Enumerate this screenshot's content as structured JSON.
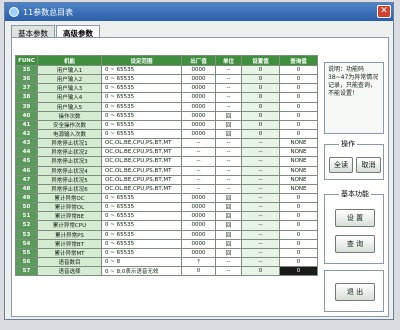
{
  "window": {
    "title": "11参数总目表"
  },
  "tabs": [
    {
      "label": "基本参数"
    },
    {
      "label": "高级参数"
    }
  ],
  "table": {
    "headers": [
      "FUNC",
      "机能",
      "设定范围",
      "出厂值",
      "单位",
      "设置值",
      "查询值"
    ],
    "rows": [
      [
        "35",
        "用户输入1",
        "0 ~ 65535",
        "0000",
        "--",
        "0",
        "0"
      ],
      [
        "36",
        "用户输入2",
        "0 ~ 65535",
        "0000",
        "--",
        "0",
        "0"
      ],
      [
        "37",
        "用户输入3",
        "0 ~ 65535",
        "0000",
        "--",
        "0",
        "0"
      ],
      [
        "38",
        "用户输入4",
        "0 ~ 65535",
        "0000",
        "--",
        "0",
        "0"
      ],
      [
        "39",
        "用户输入5",
        "0 ~ 65535",
        "0000",
        "--",
        "0",
        "0"
      ],
      [
        "40",
        "操作次数",
        "0 ~ 65535",
        "0000",
        "回",
        "0",
        "0"
      ],
      [
        "41",
        "安全操作次数",
        "0 ~ 65535",
        "0000",
        "回",
        "0",
        "0"
      ],
      [
        "42",
        "电源输入次数",
        "0 ~ 65535",
        "0000",
        "回",
        "0",
        "0"
      ],
      [
        "43",
        "异常停止状况1",
        "OC,OL,BE,CPU,PS,BT,MT",
        "--",
        "--",
        "--",
        "NONE"
      ],
      [
        "44",
        "异常停止状况2",
        "OC,OL,BE,CPU,PS,BT,MT",
        "--",
        "--",
        "--",
        "NONE"
      ],
      [
        "45",
        "异常停止状况3",
        "OC,OL,BE,CPU,PS,BT,MT",
        "--",
        "--",
        "--",
        "NONE"
      ],
      [
        "46",
        "异常停止状况4",
        "OC,OL,BE,CPU,PS,BT,MT",
        "--",
        "--",
        "--",
        "NONE"
      ],
      [
        "47",
        "异常停止状况5",
        "OC,OL,BE,CPU,PS,BT,MT",
        "--",
        "--",
        "--",
        "NONE"
      ],
      [
        "48",
        "异常停止状况6",
        "OC,OL,BE,CPU,PS,BT,MT",
        "--",
        "--",
        "--",
        "NONE"
      ],
      [
        "49",
        "累计异常OC",
        "0 ~ 65535",
        "0000",
        "回",
        "--",
        "0"
      ],
      [
        "50",
        "累计异常OL",
        "0 ~ 65535",
        "0000",
        "回",
        "--",
        "0"
      ],
      [
        "51",
        "累计异常BE",
        "0 ~ 65535",
        "0000",
        "回",
        "--",
        "0"
      ],
      [
        "52",
        "累计异常CPU",
        "0 ~ 65535",
        "0000",
        "回",
        "--",
        "0"
      ],
      [
        "53",
        "累计异常PS",
        "0 ~ 65535",
        "0000",
        "回",
        "--",
        "0"
      ],
      [
        "54",
        "累计异常BT",
        "0 ~ 65535",
        "0000",
        "回",
        "--",
        "0"
      ],
      [
        "55",
        "累计异常MT",
        "0 ~ 65535",
        "0000",
        "回",
        "--",
        "0"
      ],
      [
        "56",
        "语音数目",
        "0 ~ 8",
        "?",
        "--",
        "--",
        "0"
      ],
      [
        "57",
        "语音选择",
        "0 ~ 8,0表示语音无效",
        "0",
        "--",
        "0",
        "0"
      ]
    ]
  },
  "info": {
    "text": "说明：功能码38~47为异常情况记录，只能查询，不能设置！"
  },
  "operation": {
    "legend": "操作",
    "confirm_label": "全读",
    "cancel_label": "取消"
  },
  "functions": {
    "legend": "基本功能",
    "set_label": "设 置",
    "query_label": "查 询"
  },
  "exit_label": "退 出"
}
